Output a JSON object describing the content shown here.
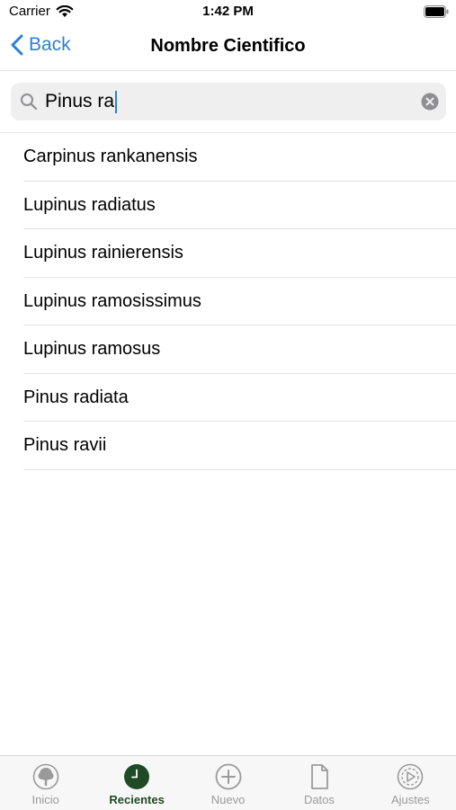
{
  "status_bar": {
    "carrier": "Carrier",
    "time": "1:42 PM"
  },
  "nav": {
    "back_label": "Back",
    "title": "Nombre Cientifico"
  },
  "search": {
    "value": "Pinus ra"
  },
  "results": [
    "Carpinus rankanensis",
    "Lupinus radiatus",
    "Lupinus rainierensis",
    "Lupinus ramosissimus",
    "Lupinus ramosus",
    "Pinus radiata",
    "Pinus ravii"
  ],
  "tabs": [
    {
      "label": "Inicio",
      "icon": "tree-icon",
      "active": false
    },
    {
      "label": "Recientes",
      "icon": "clock-icon",
      "active": true
    },
    {
      "label": "Nuevo",
      "icon": "plus-circle-icon",
      "active": false
    },
    {
      "label": "Datos",
      "icon": "document-icon",
      "active": false
    },
    {
      "label": "Ajustes",
      "icon": "play-gear-icon",
      "active": false
    }
  ],
  "colors": {
    "accent": "#2c7fd6",
    "tab_active": "#1e4a25",
    "tab_inactive": "#9a9a9a"
  }
}
